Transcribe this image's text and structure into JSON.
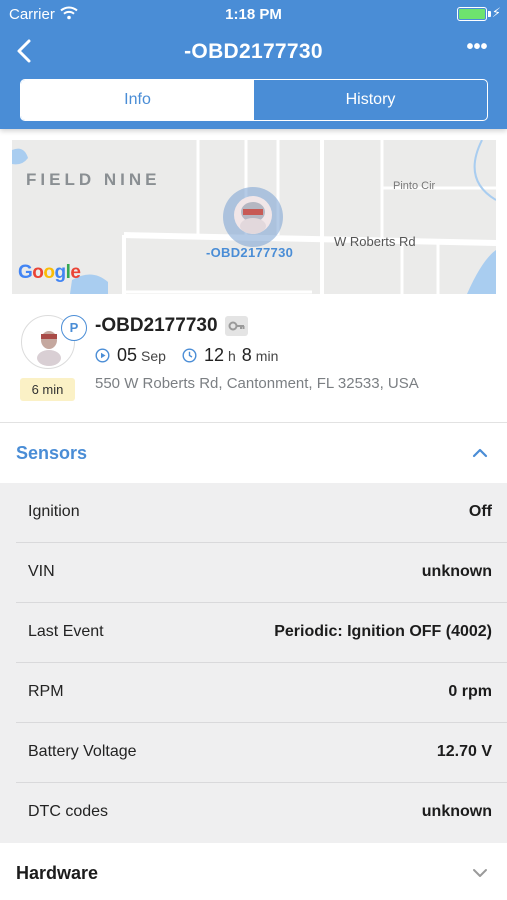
{
  "status_bar": {
    "carrier": "Carrier",
    "time": "1:18 PM"
  },
  "nav": {
    "title": "-OBD2177730",
    "more_label": "•••"
  },
  "tabs": [
    {
      "label": "Info",
      "active": true
    },
    {
      "label": "History",
      "active": false
    }
  ],
  "map": {
    "area_label": "FIELD NINE",
    "streets": {
      "w_roberts": "W Roberts Rd",
      "pinto": "Pinto Cir"
    },
    "marker_label": "-OBD2177730",
    "provider": "Google"
  },
  "vehicle": {
    "name": "-OBD2177730",
    "status_badge": "P",
    "duration": "6 min",
    "date_day": "05",
    "date_month": "Sep",
    "time_hours": "12",
    "time_hours_unit": "h",
    "time_minutes": "8",
    "time_minutes_unit": "min",
    "address": "550 W Roberts Rd, Cantonment, FL 32533, USA"
  },
  "sections": {
    "sensors_title": "Sensors",
    "hardware_title": "Hardware"
  },
  "sensors": [
    {
      "label": "Ignition",
      "value": "Off"
    },
    {
      "label": "VIN",
      "value": "unknown"
    },
    {
      "label": "Last Event",
      "value": "Periodic: Ignition OFF (4002)"
    },
    {
      "label": "RPM",
      "value": "0 rpm"
    },
    {
      "label": "Battery Voltage",
      "value": "12.70 V"
    },
    {
      "label": "DTC codes",
      "value": "unknown"
    }
  ],
  "colors": {
    "accent": "#4a8dd6",
    "badge_bg": "#fbf1c6",
    "sensor_bg": "#efeff0"
  }
}
